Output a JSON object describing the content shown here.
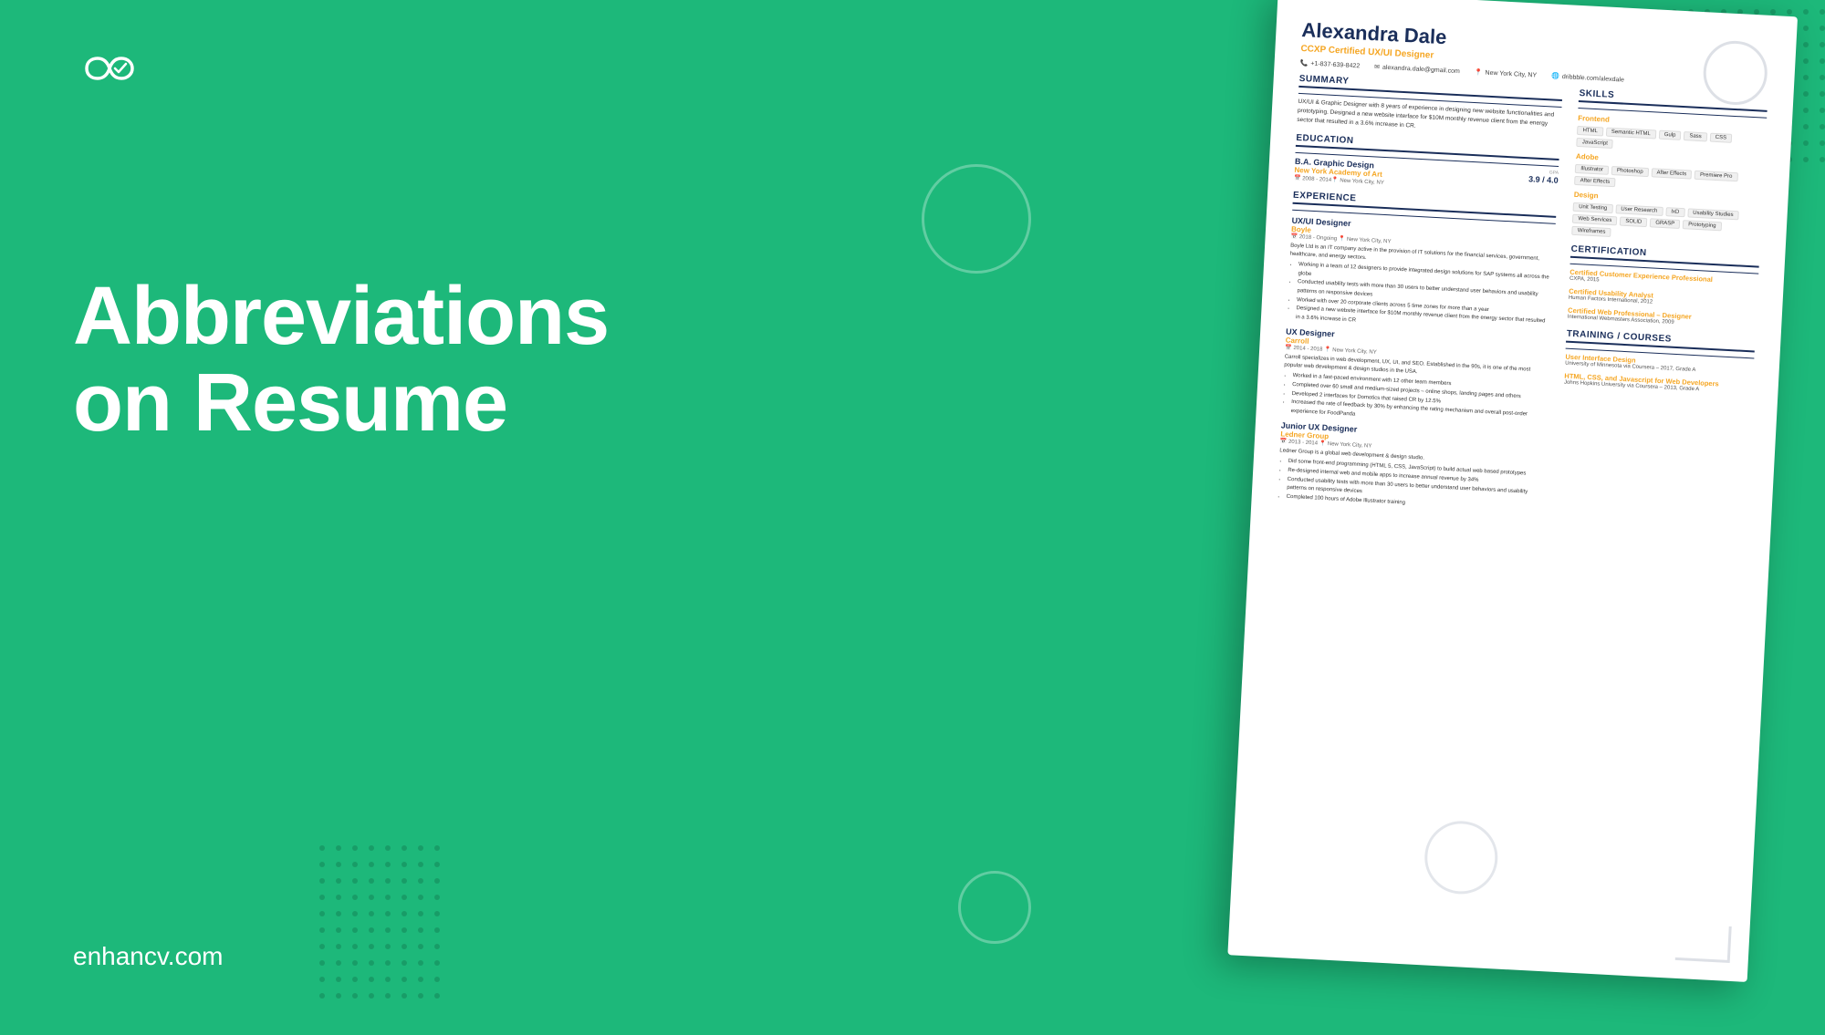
{
  "brand": {
    "logo_alt": "enhancv logo",
    "website": "enhancv.com"
  },
  "heading": {
    "line1": "Abbreviations",
    "line2": "on Resume"
  },
  "resume": {
    "name": "Alexandra Dale",
    "title": "CCXP Certified UX/UI Designer",
    "phone": "+1-837-639-8422",
    "email": "alexandra.dale@gmail.com",
    "location": "New York City, NY",
    "portfolio": "dribbble.com/alexdale",
    "summary": {
      "label": "SUMMARY",
      "text": "UX/UI & Graphic Designer with 8 years of experience in designing new website functionalities and prototyping. Designed a new website interface for $10M monthly revenue client from the energy sector that resulted in a 3.6% increase in CR."
    },
    "education": {
      "label": "EDUCATION",
      "degree": "B.A. Graphic Design",
      "school": "New York Academy of Art",
      "dates": "2008 - 2014",
      "location": "New York City, NY",
      "gpa_label": "GPA",
      "gpa": "3.9 / 4.0"
    },
    "experience": {
      "label": "EXPERIENCE",
      "jobs": [
        {
          "title": "UX/UI Designer",
          "company": "Boyle",
          "dates": "2018 - Ongoing",
          "location": "New York City, NY",
          "description": "Boyle Ltd is an IT company active in the provision of IT solutions for the financial services, government, healthcare, and energy sectors.",
          "bullets": [
            "Working in a team of 12 designers to provide integrated design solutions for SAP systems all across the globe",
            "Conducted usability tests with more than 30 users to better understand user behaviors and usability patterns on responsive devices",
            "Worked with over 20 corporate clients across 5 time zones for more than a year",
            "Designed a new website interface for $10M monthly revenue client from the energy sector that resulted in a 3.6% increase in CR"
          ]
        },
        {
          "title": "UX Designer",
          "company": "Carroll",
          "dates": "2014 - 2018",
          "location": "New York City, NY",
          "description": "Carroll specializes in web development, UX, UI, and SEO. Established in the 90s, it is one of the most popular web development & design studios in the USA.",
          "bullets": [
            "Worked in a fast-paced environment with 12 other team members",
            "Completed over 60 small and medium-sized projects – online shops, landing pages and others",
            "Developed 2 interfaces for Domotics that raised CR by 12.5%",
            "Increased the rate of feedback by 30% by enhancing the rating mechanism and overall post-order experience for FoodPanda"
          ]
        },
        {
          "title": "Junior UX Designer",
          "company": "Ledner Group",
          "dates": "2013 - 2014",
          "location": "New York City, NY",
          "description": "Ledner Group is a global web development & design studio.",
          "bullets": [
            "Did some front-end programming (HTML 5, CSS, JavaScript) to build actual web based prototypes",
            "Re-designed internal web and mobile apps to increase annual revenue by 34%",
            "Conducted usability tests with more than 30 users to better understand user behaviors and usability patterns on responsive devices",
            "Completed 100 hours of Adobe Illustrator training"
          ]
        }
      ]
    },
    "skills": {
      "label": "SKILLS",
      "categories": [
        {
          "name": "Frontend",
          "tags": [
            "HTML",
            "Semantic HTML",
            "Gulp",
            "Sass",
            "CSS",
            "JavaScript"
          ]
        },
        {
          "name": "Adobe",
          "tags": [
            "Illustrator",
            "Photoshop",
            "After Effects",
            "Premiere Pro",
            "After Effects"
          ]
        },
        {
          "name": "Design",
          "tags": [
            "Unit Testing",
            "User Research",
            "IxD",
            "Usability Studies",
            "Web Services",
            "SOLID",
            "GRASP",
            "Prototyping",
            "Wireframes"
          ]
        }
      ]
    },
    "certification": {
      "label": "CERTIFICATION",
      "items": [
        {
          "title": "Certified Customer Experience Professional",
          "org": "CXPA, 2015"
        },
        {
          "title": "Certified Usability Analyst",
          "org": "Human Factors International, 2012"
        },
        {
          "title": "Certified Web Professional – Designer",
          "org": "International Webmasters Association, 2009"
        }
      ]
    },
    "training": {
      "label": "TRAINING / COURSES",
      "items": [
        {
          "title": "User Interface Design",
          "org": "University of Minnesota via Coursera – 2017, Grade A"
        },
        {
          "title": "HTML, CSS, and Javascript for Web Developers",
          "org": "Johns Hopkins University via Coursera – 2013, Grade A"
        }
      ]
    }
  },
  "colors": {
    "green": "#1db87a",
    "dark_blue": "#1a2e5a",
    "orange": "#f5a623",
    "white": "#ffffff"
  }
}
